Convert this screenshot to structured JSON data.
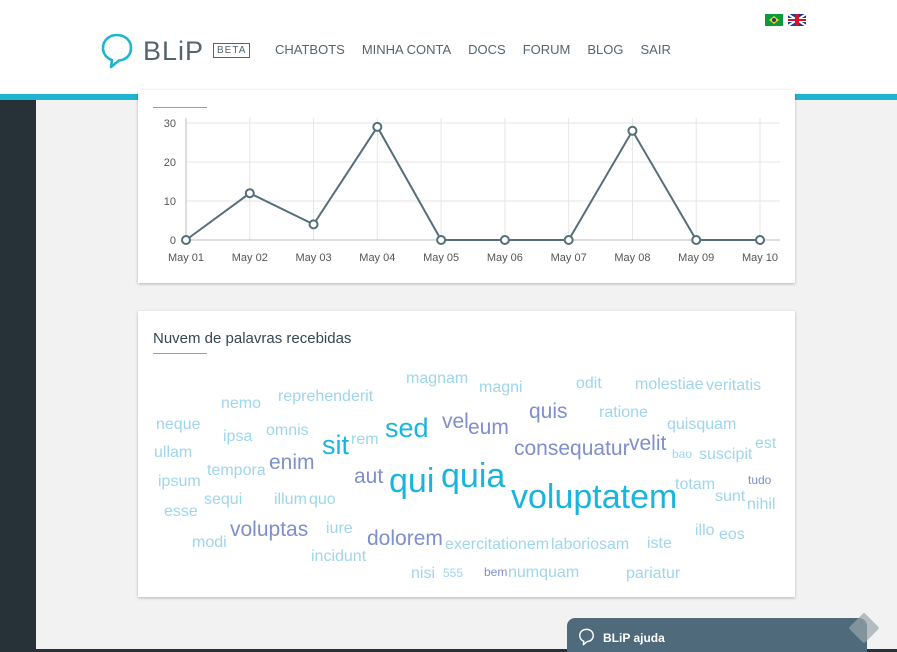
{
  "header": {
    "logo_text": "BLiP",
    "beta_label": "BETA",
    "nav": [
      "CHATBOTS",
      "MINHA CONTA",
      "DOCS",
      "FORUM",
      "BLOG",
      "SAIR"
    ],
    "flags": [
      "flag-brazil",
      "flag-uk"
    ]
  },
  "colors": {
    "accent": "#1fb4cf",
    "sidebar": "#263238",
    "text": "#55646e",
    "word_cyan": "#1ab5dd",
    "word_purple": "#7f8fcb",
    "word_light": "#9fd5ed"
  },
  "chart_data": {
    "type": "line",
    "title": "",
    "categories": [
      "May 01",
      "May 02",
      "May 03",
      "May 04",
      "May 05",
      "May 06",
      "May 07",
      "May 08",
      "May 09",
      "May 10"
    ],
    "values": [
      0,
      12,
      4,
      29,
      0,
      0,
      0,
      28,
      0,
      0
    ],
    "y_ticks": [
      "0",
      "10",
      "20",
      "30"
    ],
    "ylim": [
      0,
      30
    ],
    "grid": true,
    "color": "#546e7a"
  },
  "word_cloud": {
    "title": "Nuvem de palavras recebidas",
    "words": [
      {
        "text": "magnam",
        "weight": 2,
        "color": "light"
      },
      {
        "text": "magni",
        "weight": 2,
        "color": "light"
      },
      {
        "text": "odit",
        "weight": 2,
        "color": "light"
      },
      {
        "text": "molestiae",
        "weight": 2,
        "color": "light"
      },
      {
        "text": "veritatis",
        "weight": 2,
        "color": "light"
      },
      {
        "text": "nemo",
        "weight": 2,
        "color": "light"
      },
      {
        "text": "reprehenderit",
        "weight": 2,
        "color": "light"
      },
      {
        "text": "neque",
        "weight": 2,
        "color": "light"
      },
      {
        "text": "ipsa",
        "weight": 2,
        "color": "light"
      },
      {
        "text": "omnis",
        "weight": 2,
        "color": "light"
      },
      {
        "text": "sit",
        "weight": 4,
        "color": "cyan"
      },
      {
        "text": "rem",
        "weight": 2,
        "color": "light"
      },
      {
        "text": "sed",
        "weight": 4,
        "color": "cyan"
      },
      {
        "text": "vel",
        "weight": 3,
        "color": "purple"
      },
      {
        "text": "eum",
        "weight": 3,
        "color": "purple"
      },
      {
        "text": "quis",
        "weight": 3,
        "color": "purple"
      },
      {
        "text": "ratione",
        "weight": 2,
        "color": "light"
      },
      {
        "text": "quisquam",
        "weight": 2,
        "color": "light"
      },
      {
        "text": "est",
        "weight": 2,
        "color": "light"
      },
      {
        "text": "ullam",
        "weight": 2,
        "color": "light"
      },
      {
        "text": "enim",
        "weight": 3,
        "color": "purple"
      },
      {
        "text": "consequatur",
        "weight": 3,
        "color": "purple"
      },
      {
        "text": "velit",
        "weight": 3,
        "color": "purple"
      },
      {
        "text": "bao",
        "weight": 1,
        "color": "light"
      },
      {
        "text": "suscipit",
        "weight": 2,
        "color": "light"
      },
      {
        "text": "tempora",
        "weight": 2,
        "color": "light"
      },
      {
        "text": "ipsum",
        "weight": 2,
        "color": "light"
      },
      {
        "text": "aut",
        "weight": 3,
        "color": "purple"
      },
      {
        "text": "qui",
        "weight": 5,
        "color": "cyan"
      },
      {
        "text": "quia",
        "weight": 5,
        "color": "cyan"
      },
      {
        "text": "totam",
        "weight": 2,
        "color": "light"
      },
      {
        "text": "tudo",
        "weight": 1,
        "color": "purple"
      },
      {
        "text": "sequi",
        "weight": 2,
        "color": "light"
      },
      {
        "text": "illum",
        "weight": 2,
        "color": "light"
      },
      {
        "text": "quo",
        "weight": 2,
        "color": "light"
      },
      {
        "text": "voluptatem",
        "weight": 5,
        "color": "cyan"
      },
      {
        "text": "sunt",
        "weight": 2,
        "color": "light"
      },
      {
        "text": "nihil",
        "weight": 2,
        "color": "light"
      },
      {
        "text": "esse",
        "weight": 2,
        "color": "light"
      },
      {
        "text": "voluptas",
        "weight": 3,
        "color": "purple"
      },
      {
        "text": "iure",
        "weight": 2,
        "color": "light"
      },
      {
        "text": "illo",
        "weight": 2,
        "color": "light"
      },
      {
        "text": "eos",
        "weight": 2,
        "color": "light"
      },
      {
        "text": "modi",
        "weight": 2,
        "color": "light"
      },
      {
        "text": "dolorem",
        "weight": 3,
        "color": "purple"
      },
      {
        "text": "exercitationem",
        "weight": 2,
        "color": "light"
      },
      {
        "text": "laboriosam",
        "weight": 2,
        "color": "light"
      },
      {
        "text": "iste",
        "weight": 2,
        "color": "light"
      },
      {
        "text": "incidunt",
        "weight": 2,
        "color": "light"
      },
      {
        "text": "nisi",
        "weight": 2,
        "color": "light"
      },
      {
        "text": "555",
        "weight": 1,
        "color": "light"
      },
      {
        "text": "bem",
        "weight": 1,
        "color": "purple"
      },
      {
        "text": "numquam",
        "weight": 2,
        "color": "light"
      },
      {
        "text": "pariatur",
        "weight": 2,
        "color": "light"
      }
    ]
  },
  "help_widget": {
    "label": "BLiP ajuda"
  }
}
